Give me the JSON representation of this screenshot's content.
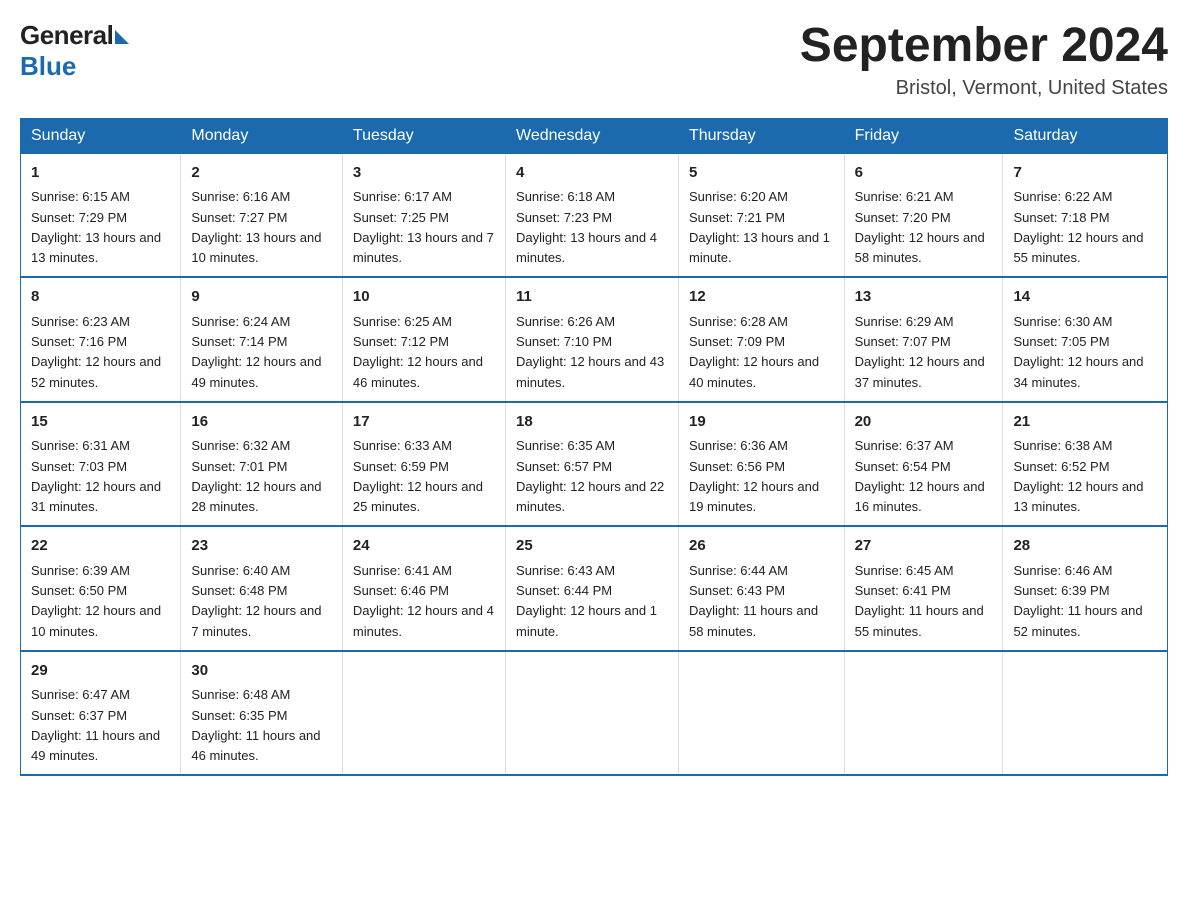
{
  "logo": {
    "general": "General",
    "blue": "Blue"
  },
  "title": "September 2024",
  "subtitle": "Bristol, Vermont, United States",
  "days_of_week": [
    "Sunday",
    "Monday",
    "Tuesday",
    "Wednesday",
    "Thursday",
    "Friday",
    "Saturday"
  ],
  "weeks": [
    [
      {
        "num": "1",
        "sunrise": "Sunrise: 6:15 AM",
        "sunset": "Sunset: 7:29 PM",
        "daylight": "Daylight: 13 hours and 13 minutes."
      },
      {
        "num": "2",
        "sunrise": "Sunrise: 6:16 AM",
        "sunset": "Sunset: 7:27 PM",
        "daylight": "Daylight: 13 hours and 10 minutes."
      },
      {
        "num": "3",
        "sunrise": "Sunrise: 6:17 AM",
        "sunset": "Sunset: 7:25 PM",
        "daylight": "Daylight: 13 hours and 7 minutes."
      },
      {
        "num": "4",
        "sunrise": "Sunrise: 6:18 AM",
        "sunset": "Sunset: 7:23 PM",
        "daylight": "Daylight: 13 hours and 4 minutes."
      },
      {
        "num": "5",
        "sunrise": "Sunrise: 6:20 AM",
        "sunset": "Sunset: 7:21 PM",
        "daylight": "Daylight: 13 hours and 1 minute."
      },
      {
        "num": "6",
        "sunrise": "Sunrise: 6:21 AM",
        "sunset": "Sunset: 7:20 PM",
        "daylight": "Daylight: 12 hours and 58 minutes."
      },
      {
        "num": "7",
        "sunrise": "Sunrise: 6:22 AM",
        "sunset": "Sunset: 7:18 PM",
        "daylight": "Daylight: 12 hours and 55 minutes."
      }
    ],
    [
      {
        "num": "8",
        "sunrise": "Sunrise: 6:23 AM",
        "sunset": "Sunset: 7:16 PM",
        "daylight": "Daylight: 12 hours and 52 minutes."
      },
      {
        "num": "9",
        "sunrise": "Sunrise: 6:24 AM",
        "sunset": "Sunset: 7:14 PM",
        "daylight": "Daylight: 12 hours and 49 minutes."
      },
      {
        "num": "10",
        "sunrise": "Sunrise: 6:25 AM",
        "sunset": "Sunset: 7:12 PM",
        "daylight": "Daylight: 12 hours and 46 minutes."
      },
      {
        "num": "11",
        "sunrise": "Sunrise: 6:26 AM",
        "sunset": "Sunset: 7:10 PM",
        "daylight": "Daylight: 12 hours and 43 minutes."
      },
      {
        "num": "12",
        "sunrise": "Sunrise: 6:28 AM",
        "sunset": "Sunset: 7:09 PM",
        "daylight": "Daylight: 12 hours and 40 minutes."
      },
      {
        "num": "13",
        "sunrise": "Sunrise: 6:29 AM",
        "sunset": "Sunset: 7:07 PM",
        "daylight": "Daylight: 12 hours and 37 minutes."
      },
      {
        "num": "14",
        "sunrise": "Sunrise: 6:30 AM",
        "sunset": "Sunset: 7:05 PM",
        "daylight": "Daylight: 12 hours and 34 minutes."
      }
    ],
    [
      {
        "num": "15",
        "sunrise": "Sunrise: 6:31 AM",
        "sunset": "Sunset: 7:03 PM",
        "daylight": "Daylight: 12 hours and 31 minutes."
      },
      {
        "num": "16",
        "sunrise": "Sunrise: 6:32 AM",
        "sunset": "Sunset: 7:01 PM",
        "daylight": "Daylight: 12 hours and 28 minutes."
      },
      {
        "num": "17",
        "sunrise": "Sunrise: 6:33 AM",
        "sunset": "Sunset: 6:59 PM",
        "daylight": "Daylight: 12 hours and 25 minutes."
      },
      {
        "num": "18",
        "sunrise": "Sunrise: 6:35 AM",
        "sunset": "Sunset: 6:57 PM",
        "daylight": "Daylight: 12 hours and 22 minutes."
      },
      {
        "num": "19",
        "sunrise": "Sunrise: 6:36 AM",
        "sunset": "Sunset: 6:56 PM",
        "daylight": "Daylight: 12 hours and 19 minutes."
      },
      {
        "num": "20",
        "sunrise": "Sunrise: 6:37 AM",
        "sunset": "Sunset: 6:54 PM",
        "daylight": "Daylight: 12 hours and 16 minutes."
      },
      {
        "num": "21",
        "sunrise": "Sunrise: 6:38 AM",
        "sunset": "Sunset: 6:52 PM",
        "daylight": "Daylight: 12 hours and 13 minutes."
      }
    ],
    [
      {
        "num": "22",
        "sunrise": "Sunrise: 6:39 AM",
        "sunset": "Sunset: 6:50 PM",
        "daylight": "Daylight: 12 hours and 10 minutes."
      },
      {
        "num": "23",
        "sunrise": "Sunrise: 6:40 AM",
        "sunset": "Sunset: 6:48 PM",
        "daylight": "Daylight: 12 hours and 7 minutes."
      },
      {
        "num": "24",
        "sunrise": "Sunrise: 6:41 AM",
        "sunset": "Sunset: 6:46 PM",
        "daylight": "Daylight: 12 hours and 4 minutes."
      },
      {
        "num": "25",
        "sunrise": "Sunrise: 6:43 AM",
        "sunset": "Sunset: 6:44 PM",
        "daylight": "Daylight: 12 hours and 1 minute."
      },
      {
        "num": "26",
        "sunrise": "Sunrise: 6:44 AM",
        "sunset": "Sunset: 6:43 PM",
        "daylight": "Daylight: 11 hours and 58 minutes."
      },
      {
        "num": "27",
        "sunrise": "Sunrise: 6:45 AM",
        "sunset": "Sunset: 6:41 PM",
        "daylight": "Daylight: 11 hours and 55 minutes."
      },
      {
        "num": "28",
        "sunrise": "Sunrise: 6:46 AM",
        "sunset": "Sunset: 6:39 PM",
        "daylight": "Daylight: 11 hours and 52 minutes."
      }
    ],
    [
      {
        "num": "29",
        "sunrise": "Sunrise: 6:47 AM",
        "sunset": "Sunset: 6:37 PM",
        "daylight": "Daylight: 11 hours and 49 minutes."
      },
      {
        "num": "30",
        "sunrise": "Sunrise: 6:48 AM",
        "sunset": "Sunset: 6:35 PM",
        "daylight": "Daylight: 11 hours and 46 minutes."
      },
      {
        "num": "",
        "sunrise": "",
        "sunset": "",
        "daylight": ""
      },
      {
        "num": "",
        "sunrise": "",
        "sunset": "",
        "daylight": ""
      },
      {
        "num": "",
        "sunrise": "",
        "sunset": "",
        "daylight": ""
      },
      {
        "num": "",
        "sunrise": "",
        "sunset": "",
        "daylight": ""
      },
      {
        "num": "",
        "sunrise": "",
        "sunset": "",
        "daylight": ""
      }
    ]
  ]
}
